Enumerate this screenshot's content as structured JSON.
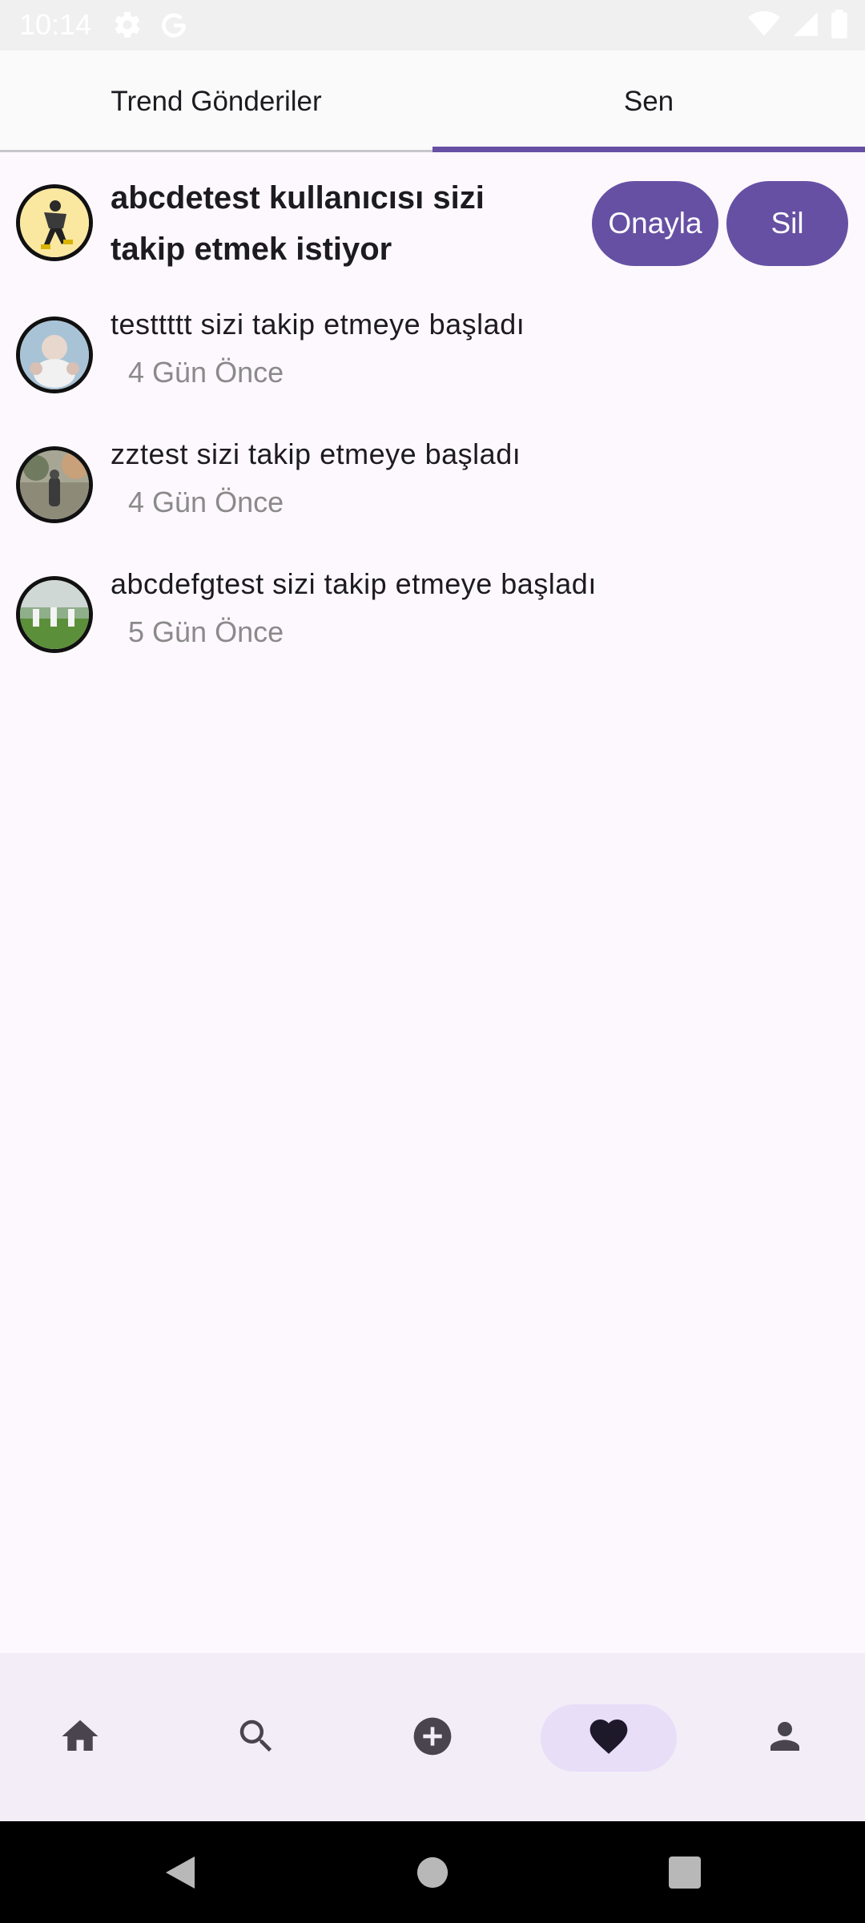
{
  "status_bar": {
    "time": "10:14"
  },
  "tabs": [
    {
      "label": "Trend Gönderiler",
      "active": false
    },
    {
      "label": "Sen",
      "active": true
    }
  ],
  "follow_request": {
    "line1": "abcdetest kullanıcısı sizi",
    "line2": "takip etmek istiyor",
    "approve_label": "Onayla",
    "delete_label": "Sil"
  },
  "notifications": [
    {
      "text": "testtttt sizi takip etmeye başladı",
      "time": "4 Gün Önce"
    },
    {
      "text": "zztest sizi takip etmeye başladı",
      "time": "4 Gün Önce"
    },
    {
      "text": "abcdefgtest sizi takip etmeye başladı",
      "time": "5 Gün Önce"
    }
  ],
  "bottom_nav": [
    {
      "icon": "home-icon",
      "active": false
    },
    {
      "icon": "search-icon",
      "active": false
    },
    {
      "icon": "add-circle-icon",
      "active": false
    },
    {
      "icon": "heart-icon",
      "active": true
    },
    {
      "icon": "person-icon",
      "active": false
    }
  ],
  "colors": {
    "accent": "#6650a4",
    "nav_active": "#e8def8",
    "nav_bg": "#f2edf7",
    "background": "#fdf8fd"
  }
}
